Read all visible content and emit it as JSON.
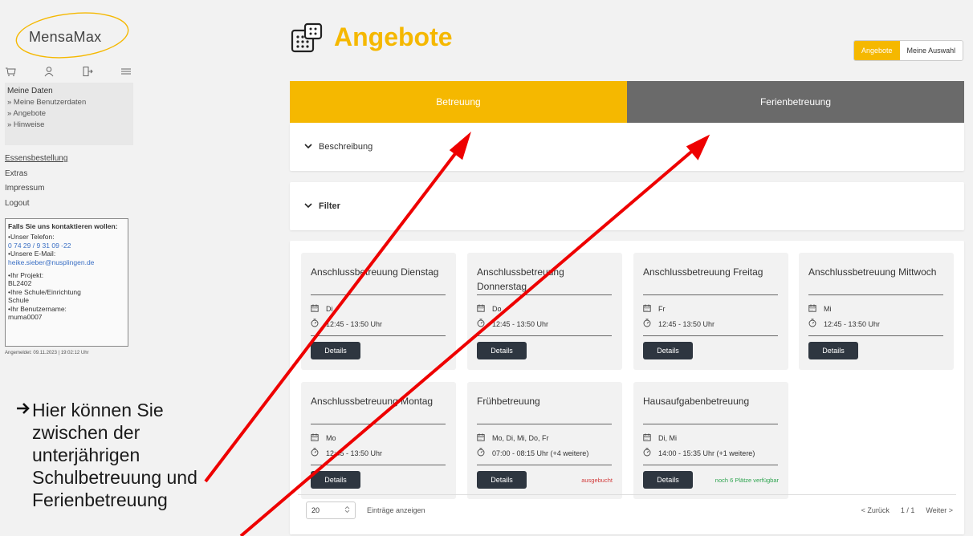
{
  "app": {
    "logo_text": "MensaMax"
  },
  "sidebar": {
    "icons": [
      "cart-icon",
      "user-icon",
      "logout-icon",
      "menu-icon"
    ],
    "meine_daten": {
      "title": "Meine Daten",
      "items": [
        "» Meine Benutzerdaten",
        "» Angebote",
        "» Hinweise"
      ]
    },
    "links": [
      {
        "label": "Essensbestellung",
        "underline": true
      },
      {
        "label": "Extras",
        "underline": false
      },
      {
        "label": "Impressum",
        "underline": false
      },
      {
        "label": "Logout",
        "underline": false
      }
    ],
    "contact": {
      "heading": "Falls Sie uns kontaktieren wollen:",
      "phone_label": "•Unser Telefon:",
      "phone": "0 74 29 / 9 31 09 -22",
      "email_label": "•Unsere E-Mail:",
      "email": "heike.sieber@nusplingen.de",
      "projekt_label": "•Ihr Projekt:",
      "projekt": "BL2402",
      "schule_label": "•Ihre Schule/Einrichtung",
      "schule": "Schule",
      "benutzer_label": "•Ihr Benutzername:",
      "benutzer": "muma0007"
    },
    "angemeldet": "Angemeldet: 09.11.2023 | 19:02:12 Uhr"
  },
  "header": {
    "title": "Angebote",
    "toggle": {
      "active": "Angebote",
      "other": "Meine Auswahl"
    }
  },
  "tabs": {
    "active": "Betreuung",
    "inactive": "Ferienbetreuung"
  },
  "panels": {
    "beschreibung": "Beschreibung",
    "filter": "Filter"
  },
  "cards": [
    {
      "title": "Anschlussbetreuung Dienstag",
      "days": "Di",
      "time": "12:45 - 13:50 Uhr",
      "button": "Details",
      "status": ""
    },
    {
      "title": "Anschlussbetreuung Donnerstag",
      "days": "Do",
      "time": "12:45 - 13:50 Uhr",
      "button": "Details",
      "status": ""
    },
    {
      "title": "Anschlussbetreuung Freitag",
      "days": "Fr",
      "time": "12:45 - 13:50 Uhr",
      "button": "Details",
      "status": ""
    },
    {
      "title": "Anschlussbetreuung Mittwoch",
      "days": "Mi",
      "time": "12:45 - 13:50 Uhr",
      "button": "Details",
      "status": ""
    },
    {
      "title": "Anschlussbetreuung Montag",
      "days": "Mo",
      "time": "12:45 - 13:50 Uhr",
      "button": "Details",
      "status": ""
    },
    {
      "title": "Frühbetreuung",
      "days": "Mo, Di, Mi, Do, Fr",
      "time": "07:00 - 08:15 Uhr (+4 weitere)",
      "button": "Details",
      "status": "ausgebucht",
      "status_color": "#d23b3b"
    },
    {
      "title": "Hausaufgabenbetreuung",
      "days": "Di, Mi",
      "time": "14:00 - 15:35 Uhr (+1 weitere)",
      "button": "Details",
      "status": "noch 6 Plätze verfügbar",
      "status_color": "#2ea44f"
    }
  ],
  "pagination": {
    "per_page": "20",
    "per_page_label": "Einträge anzeigen",
    "prev": "< Zurück",
    "page": "1 / 1",
    "next": "Weiter >"
  },
  "annotation": {
    "lines": [
      "Hier können Sie",
      "zwischen der",
      "unterjährigen",
      "Schulbetreuung und",
      "Ferienbetreuung"
    ],
    "arrow_color": "#ee0000"
  },
  "colors": {
    "accent": "#f5b800",
    "tab_inactive": "#6a6a6a",
    "button_dark": "#2e3640"
  }
}
